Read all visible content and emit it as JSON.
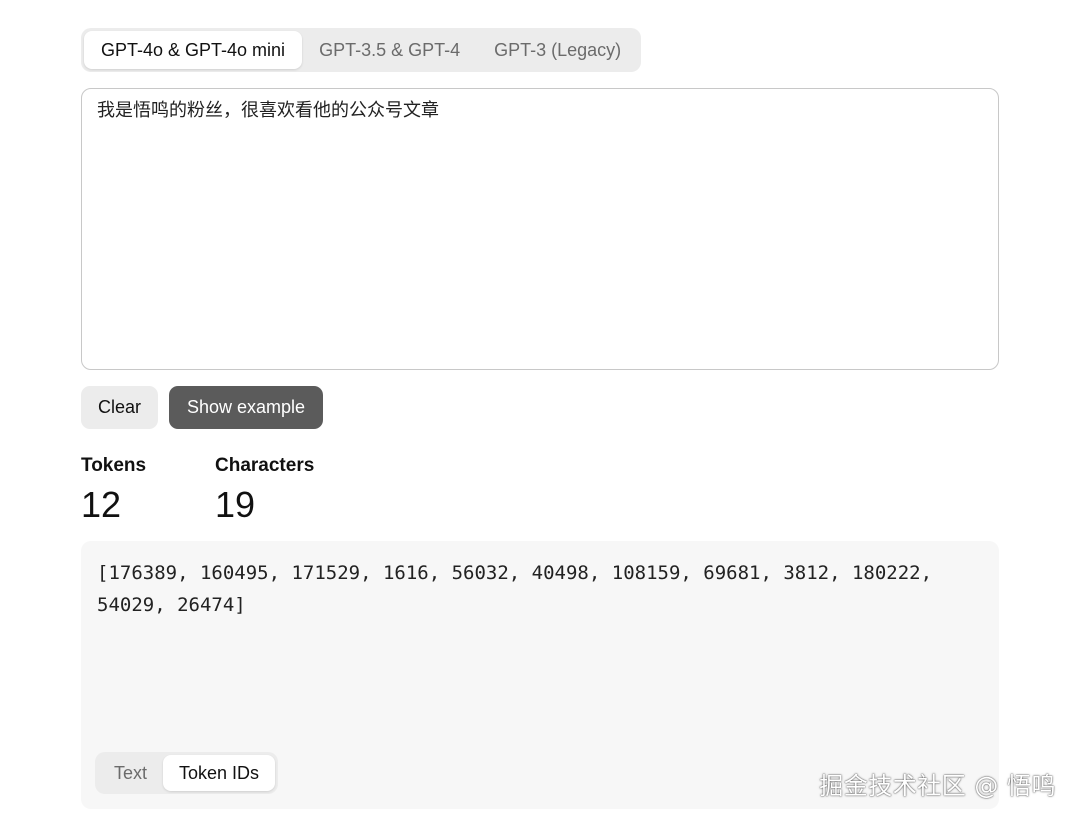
{
  "model_tabs": [
    {
      "label": "GPT-4o & GPT-4o mini",
      "active": true
    },
    {
      "label": "GPT-3.5 & GPT-4",
      "active": false
    },
    {
      "label": "GPT-3 (Legacy)",
      "active": false
    }
  ],
  "input": {
    "value": "我是悟鸣的粉丝，很喜欢看他的公众号文章"
  },
  "buttons": {
    "clear": "Clear",
    "show_example": "Show example"
  },
  "stats": {
    "tokens_label": "Tokens",
    "tokens_value": "12",
    "characters_label": "Characters",
    "characters_value": "19"
  },
  "output": {
    "token_ids": "[176389, 160495, 171529, 1616, 56032, 40498, 108159, 69681, 3812, 180222, 54029, 26474]"
  },
  "view_tabs": [
    {
      "label": "Text",
      "active": false
    },
    {
      "label": "Token IDs",
      "active": true
    }
  ],
  "watermark": "掘金技术社区 @ 悟鸣",
  "colors": {
    "primary_button": "#5b5b5b",
    "segment_bg": "#ececec",
    "output_bg": "#f7f7f7"
  }
}
